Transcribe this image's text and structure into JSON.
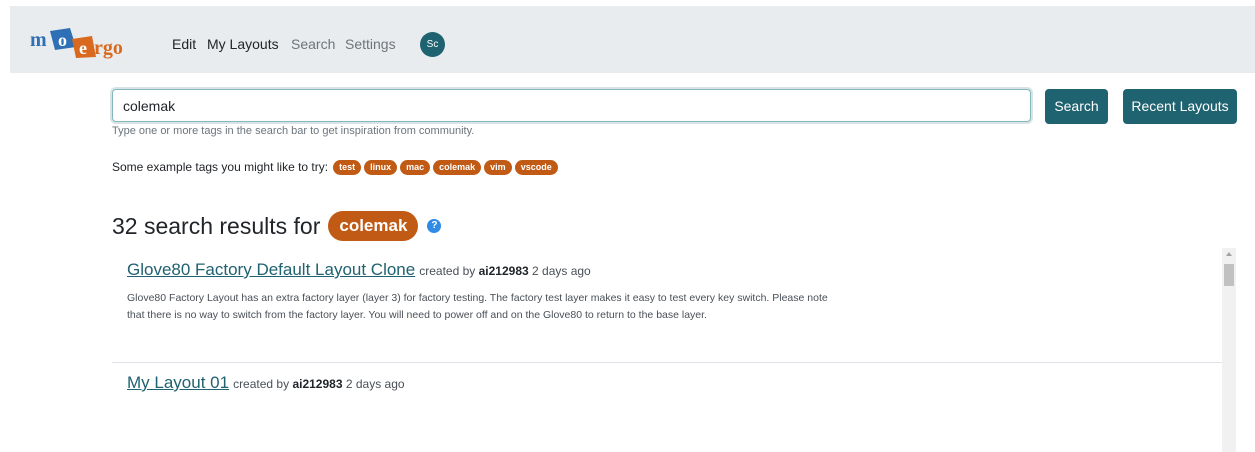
{
  "navbar": {
    "logo_text": "mo ergo",
    "links": [
      "Edit",
      "My Layouts",
      "Search",
      "Settings"
    ],
    "avatar_initials": "Sc"
  },
  "search": {
    "value": "colemak",
    "placeholder": "",
    "search_button": "Search",
    "recent_button": "Recent Layouts",
    "hint": "Type one or more tags in the search bar to get inspiration from community."
  },
  "examples": {
    "label": "Some example tags you might like to try:",
    "tags": [
      "test",
      "linux",
      "mac",
      "colemak",
      "vim",
      "vscode"
    ]
  },
  "results": {
    "count_text": "32 search results for",
    "query_tag": "colemak",
    "help_icon": "?",
    "items": [
      {
        "title": "Glove80 Factory Default Layout Clone",
        "created_by": "created by",
        "author": "ai212983",
        "age": "2 days ago",
        "description": "Glove80 Factory Layout has an extra factory layer (layer 3) for factory testing. The factory test layer makes it easy to test every key switch. Please note that there is no way to switch from the factory layer. You will need to power off and on the Glove80 to return to the base layer."
      },
      {
        "title": "My Layout 01",
        "created_by": "created by",
        "author": "ai212983",
        "age": "2 days ago"
      }
    ]
  },
  "colors": {
    "navbar_bg": "#e9ecef",
    "primary_button": "#1f6270",
    "tag_orange": "#c05a14",
    "link_teal": "#1f6270",
    "help_icon_blue": "#2f8be6",
    "logo_blue": "#2f6fb5",
    "logo_orange": "#d9691f"
  },
  "icons": {
    "help": "question-circle-icon",
    "scroll_up": "scroll-up-arrow-icon"
  }
}
